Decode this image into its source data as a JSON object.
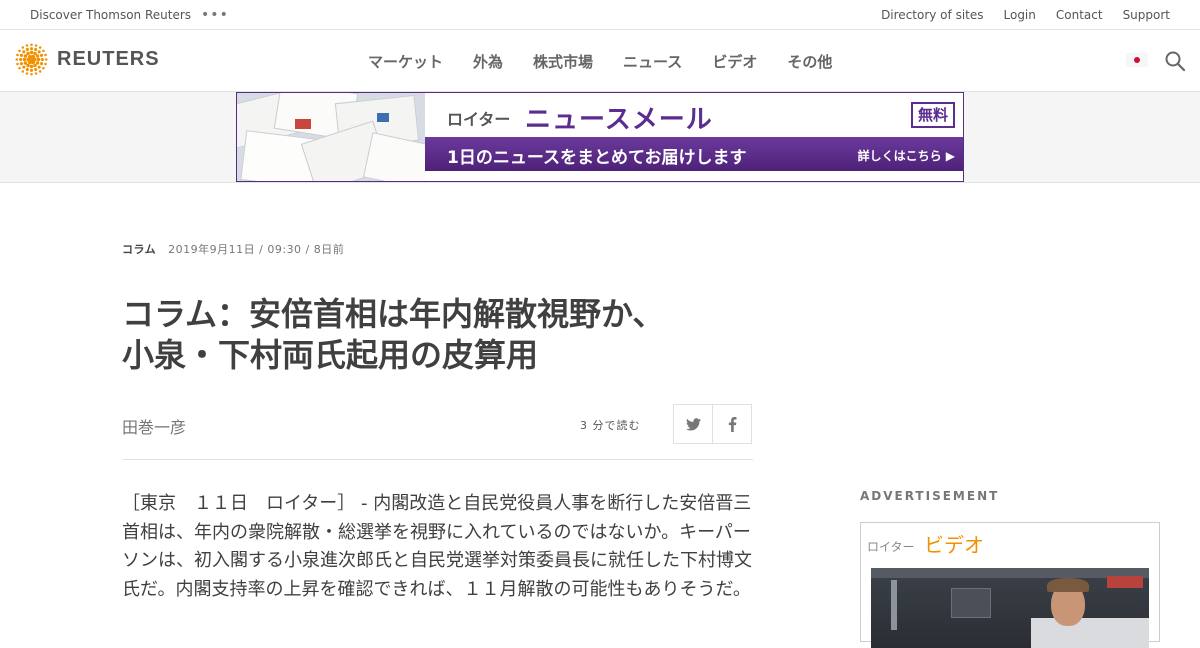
{
  "utility_bar": {
    "left_link": "Discover Thomson Reuters",
    "more": "•••",
    "right_links": [
      "Directory of sites",
      "Login",
      "Contact",
      "Support"
    ]
  },
  "nav": {
    "logo_text": "REUTERS",
    "menu": [
      "マーケット",
      "外為",
      "株式市場",
      "ニュース",
      "ビデオ",
      "その他"
    ]
  },
  "banner": {
    "brand": "ロイター",
    "title": "ニュースメール",
    "badge": "無料",
    "subtitle": "1日のニュースをまとめてお届けします",
    "link": "詳しくはこちら ▶"
  },
  "article": {
    "category": "コラム",
    "date": "2019年9月11日 / 09:30 / 8日前",
    "headline_line1": "コラム：安倍首相は年内解散視野か、",
    "headline_line2": "小泉・下村両氏起用の皮算用",
    "author": "田巻一彦",
    "read_time": "3 分で読む",
    "body": "［東京　１１日　ロイター］ - 内閣改造と自民党役員人事を断行した安倍晋三首相は、年内の衆院解散・総選挙を視野に入れているのではないか。キーパーソンは、初入閣する小泉進次郎氏と自民党選挙対策委員長に就任した下村博文氏だ。内閣支持率の上昇を確認できれば、１１月解散の可能性もありそうだ。"
  },
  "sidebar": {
    "ad_label": "ADVERTISEMENT",
    "video_brand": "ロイター",
    "video_title": "ビデオ"
  },
  "colors": {
    "banner_purple": "#5b2d8e",
    "logo_orange": "#f29100",
    "video_orange": "#f29100"
  }
}
